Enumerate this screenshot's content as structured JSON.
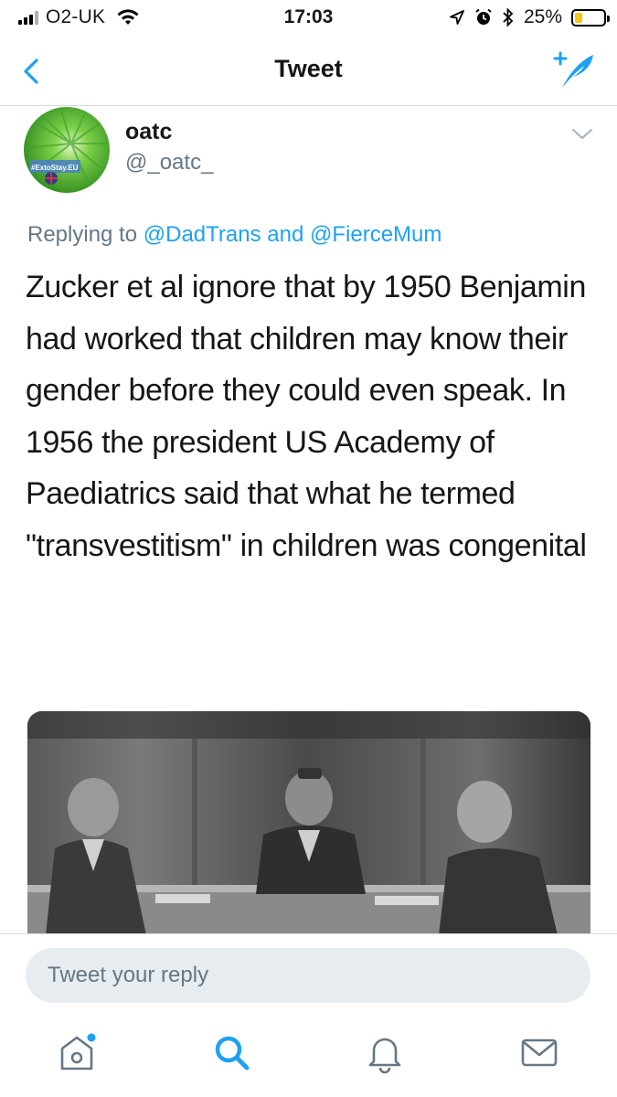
{
  "status_bar": {
    "carrier": "O2-UK",
    "time": "17:03",
    "battery_percent": "25%",
    "battery_level": 0.25,
    "icons": [
      "signal-icon",
      "wifi-icon",
      "location-arrow-icon",
      "alarm-icon",
      "bluetooth-icon",
      "battery-icon"
    ]
  },
  "nav": {
    "title": "Tweet",
    "back_icon": "chevron-left-icon",
    "compose_icon": "compose-tweet-icon"
  },
  "tweet": {
    "display_name": "oatc",
    "handle": "@_oatc_",
    "avatar_text": "#ExtoStay.EU",
    "reply_prefix": "Replying to",
    "reply_to_1": "@DadTrans",
    "reply_and": "and",
    "reply_to_2": "@FierceMum",
    "text": "Zucker et al ignore that by 1950 Benjamin had worked that children may know their gender before they could even speak. In 1956 the president US Academy of Paediatrics said that what he termed \"transvestitism\" in children was congenital",
    "more_icon": "chevron-down-icon"
  },
  "reply_box": {
    "placeholder": "Tweet your reply"
  },
  "tab_bar": {
    "items": [
      "home-icon",
      "search-icon",
      "notifications-icon",
      "messages-icon"
    ],
    "accent": "#1da1f2"
  },
  "colors": {
    "accent": "#1da1f2",
    "secondary_text": "#657786",
    "battery": "#f5c518"
  }
}
